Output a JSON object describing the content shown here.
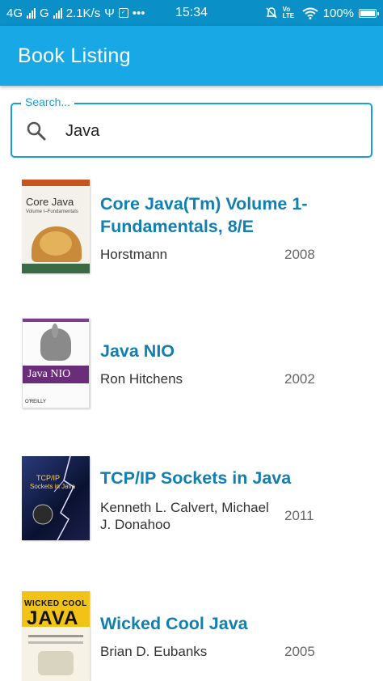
{
  "status_bar": {
    "network": "4G",
    "network2": "G",
    "speed": "2.1K/s",
    "time": "15:34",
    "volte": "Vo LTE",
    "battery": "100%"
  },
  "app_bar": {
    "title": "Book Listing"
  },
  "search": {
    "label": "Search...",
    "value": "Java"
  },
  "books": [
    {
      "title": "Core Java(Tm) Volume 1-Fundamentals, 8/E",
      "author": "Horstmann",
      "year": "2008",
      "cover_text": [
        "Core Java",
        "Volume I–Fundamentals"
      ]
    },
    {
      "title": "Java NIO",
      "author": "Ron Hitchens",
      "year": "2002",
      "cover_text": [
        "Java NIO",
        "O'REILLY"
      ]
    },
    {
      "title": "TCP/IP Sockets in Java",
      "author": "Kenneth L. Calvert, Michael J. Donahoo",
      "year": "2011",
      "cover_text": [
        "TCP/IP",
        "Sockets in Java"
      ]
    },
    {
      "title": "Wicked Cool Java",
      "author": "Brian D. Eubanks",
      "year": "2005",
      "cover_text": [
        "WICKED COOL",
        "JAVA"
      ]
    }
  ],
  "colors": {
    "status_bar": "#0a8fc7",
    "app_bar": "#19a8e6",
    "accent": "#1a9fd5",
    "title_text": "#1180b0"
  }
}
